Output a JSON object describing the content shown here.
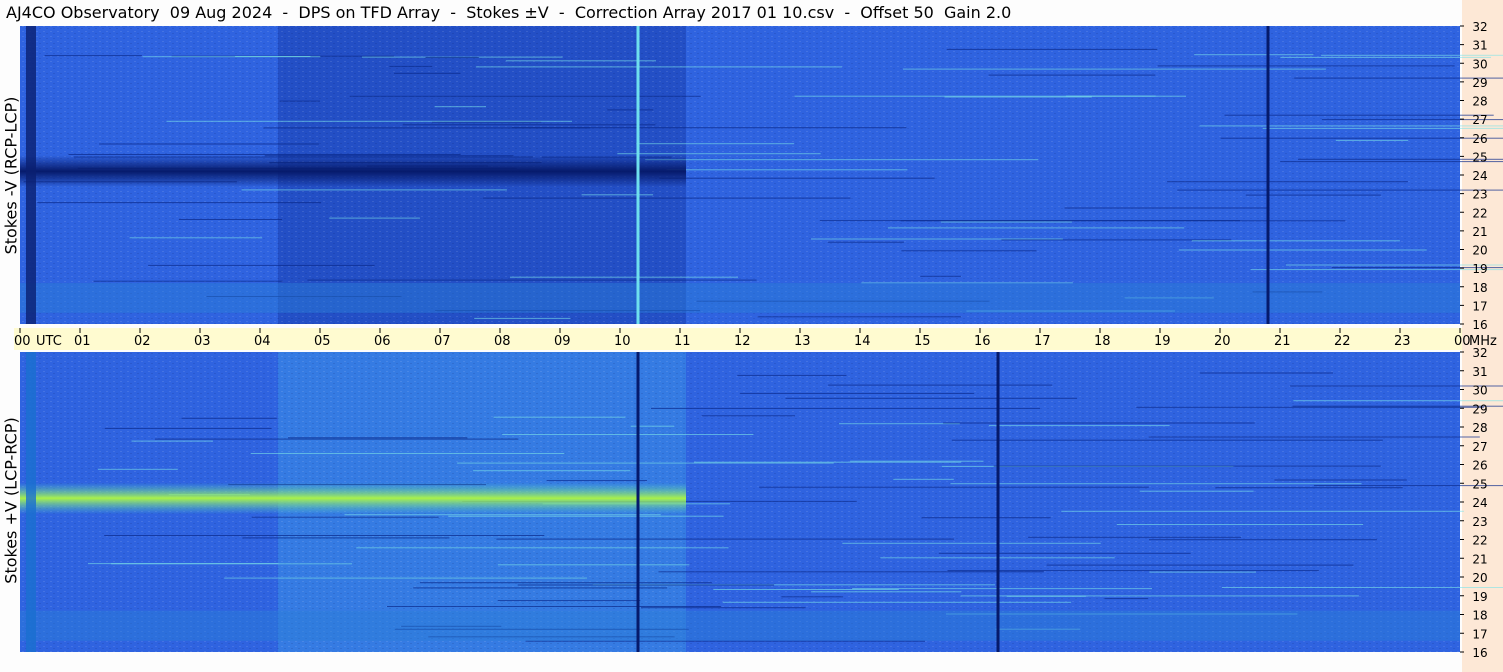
{
  "title": "AJ4CO Observatory  09 Aug 2024  -  DPS on TFD Array  -  Stokes ±V  -  Correction Array 2017 01 10.csv  -  Offset 50  Gain 2.0",
  "colors": {
    "background": "#fdfdfd",
    "freq_strip": "#fde8d6",
    "time_axis": "#fffbd0",
    "spectrogram_base": "#2f63e0",
    "spectrogram_dark": "#061a6b",
    "spectrogram_bright": "#a8f04a"
  },
  "chart_data": [
    {
      "type": "heatmap",
      "name": "Stokes -V (RCP-LCP)",
      "ylabel": "Stokes -V (RCP-LCP)",
      "y_unit": "MHz",
      "y_ticks": [
        "32",
        "31",
        "30",
        "29",
        "28",
        "27",
        "26",
        "25",
        "24",
        "23",
        "22",
        "21",
        "20",
        "19",
        "18",
        "17",
        "16"
      ],
      "ylim": [
        16,
        32
      ],
      "xlim_hours_utc": [
        0,
        24
      ],
      "bands": [
        {
          "freq_mhz": 24.2,
          "t_start": 0.0,
          "t_end": 11.1,
          "level": "dark"
        }
      ],
      "vlines": [
        {
          "t_utc": 10.3,
          "level": "bright"
        },
        {
          "t_utc": 20.8,
          "level": "dark"
        }
      ]
    },
    {
      "type": "heatmap",
      "name": "Stokes +V (LCP-RCP)",
      "ylabel": "Stokes +V (LCP-RCP)",
      "y_unit": "MHz",
      "y_ticks": [
        "32",
        "31",
        "30",
        "29",
        "28",
        "27",
        "26",
        "25",
        "24",
        "23",
        "22",
        "21",
        "20",
        "19",
        "18",
        "17",
        "16"
      ],
      "ylim": [
        16,
        32
      ],
      "xlim_hours_utc": [
        0,
        24
      ],
      "bands": [
        {
          "freq_mhz": 24.2,
          "t_start": 0.0,
          "t_end": 11.1,
          "level": "bright"
        }
      ],
      "vlines": [
        {
          "t_utc": 10.3,
          "level": "dark"
        },
        {
          "t_utc": 16.3,
          "level": "dark"
        }
      ]
    }
  ],
  "time_axis": {
    "ticks": [
      "00",
      "01",
      "02",
      "03",
      "04",
      "05",
      "06",
      "07",
      "08",
      "09",
      "10",
      "11",
      "12",
      "13",
      "14",
      "15",
      "16",
      "17",
      "18",
      "19",
      "20",
      "21",
      "22",
      "23",
      "00"
    ],
    "unit_left": "UTC",
    "unit_right": "MHz"
  }
}
